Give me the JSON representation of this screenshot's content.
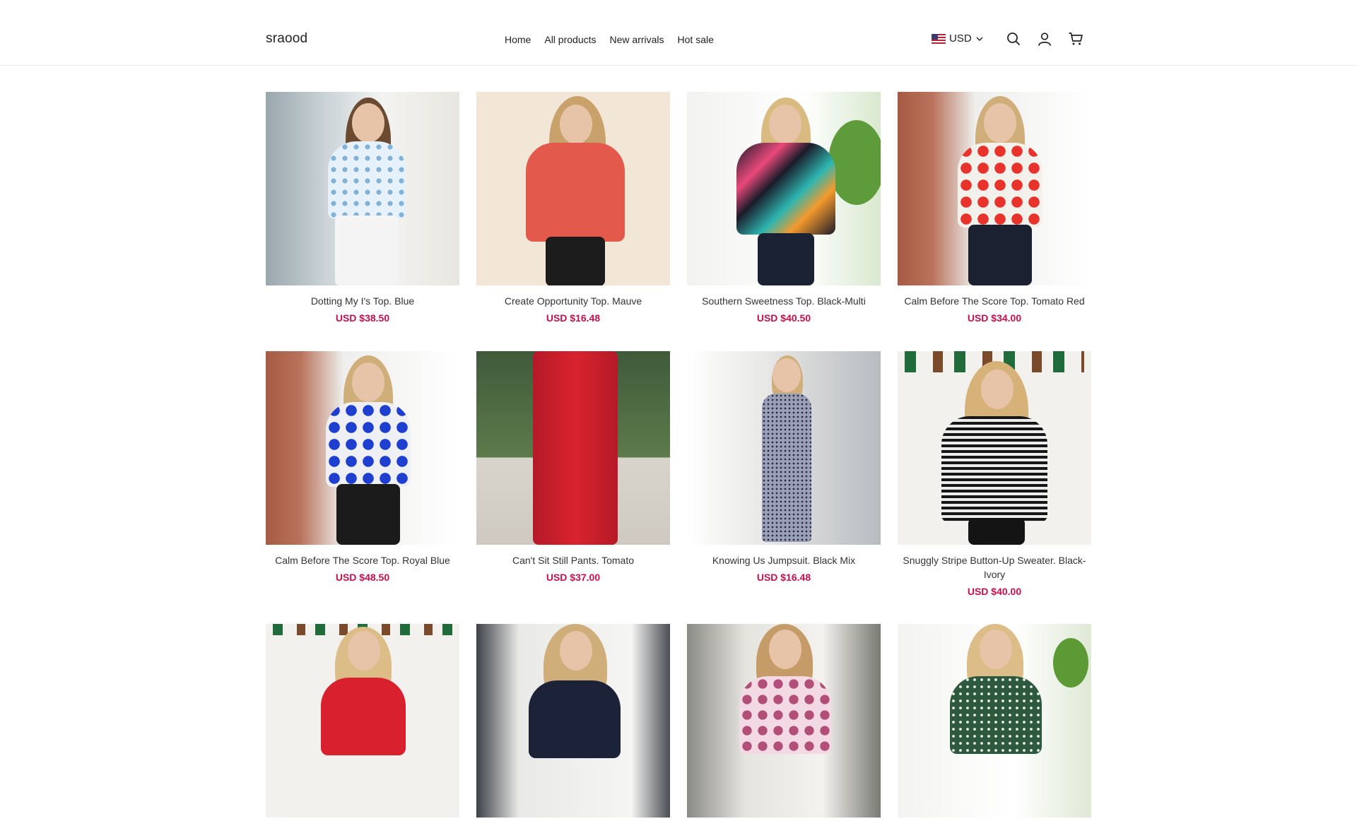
{
  "header": {
    "logo": "sraood",
    "nav": [
      "Home",
      "All products",
      "New arrivals",
      "Hot sale"
    ],
    "currency": "USD"
  },
  "icons": {
    "flag": "us-flag-icon",
    "currency_chevron": "chevron-down-icon",
    "search": "search-icon",
    "account": "user-icon",
    "cart": "cart-icon"
  },
  "colors": {
    "price": "#c4114b",
    "text": "#222222",
    "divider": "#ececec"
  },
  "products": [
    {
      "name": "Dotting My I's Top. Blue",
      "price": "USD $38.50"
    },
    {
      "name": "Create Opportunity Top. Mauve",
      "price": "USD $16.48"
    },
    {
      "name": "Southern Sweetness Top. Black-Multi",
      "price": "USD $40.50"
    },
    {
      "name": "Calm Before The Score Top. Tomato Red",
      "price": "USD $34.00"
    },
    {
      "name": "Calm Before The Score Top. Royal Blue",
      "price": "USD $48.50"
    },
    {
      "name": "Can't Sit Still Pants. Tomato",
      "price": "USD $37.00"
    },
    {
      "name": "Knowing Us Jumpsuit. Black Mix",
      "price": "USD $16.48"
    },
    {
      "name": "Snuggly Stripe Button-Up Sweater. Black-Ivory",
      "price": "USD $40.00"
    },
    {
      "name": "",
      "price": ""
    },
    {
      "name": "",
      "price": ""
    },
    {
      "name": "",
      "price": ""
    },
    {
      "name": "",
      "price": ""
    }
  ]
}
